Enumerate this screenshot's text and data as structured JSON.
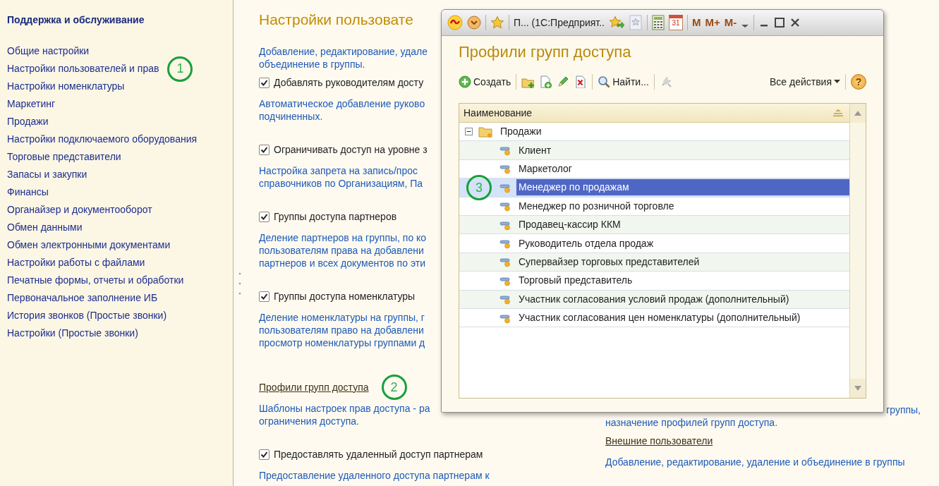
{
  "sidebar": {
    "title": "Поддержка и обслуживание",
    "items": [
      {
        "label": "Общие настройки"
      },
      {
        "label": "Настройки пользователей и прав",
        "annotation": "1"
      },
      {
        "label": "Настройки номенклатуры"
      },
      {
        "label": "Маркетинг"
      },
      {
        "label": "Продажи"
      },
      {
        "label": "Настройки подключаемого оборудования"
      },
      {
        "label": "Торговые представители"
      },
      {
        "label": "Запасы и закупки"
      },
      {
        "label": "Финансы"
      },
      {
        "label": "Органайзер и документооборот"
      },
      {
        "label": "Обмен данными"
      },
      {
        "label": "Обмен электронными документами"
      },
      {
        "label": "Настройки работы с файлами"
      },
      {
        "label": "Печатные формы, отчеты и обработки"
      },
      {
        "label": "Первоначальное заполнение ИБ"
      },
      {
        "label": "История звонков (Простые звонки)"
      },
      {
        "label": "Настройки (Простые звонки)"
      }
    ]
  },
  "main": {
    "title": "Настройки пользовате",
    "left": [
      {
        "kind": "text",
        "description": [
          "Добавление, редактирование, удале",
          "объединение в группы."
        ]
      },
      {
        "kind": "checkbox",
        "label": "Добавлять руководителям досту",
        "checked": true,
        "description": [
          "Автоматическое добавление руково",
          "подчиненных."
        ]
      },
      {
        "kind": "checkbox",
        "label": "Ограничивать доступ на уровне з",
        "checked": true,
        "description": [
          "Настройка запрета на запись/прос",
          "справочников по Организациям, Па"
        ]
      },
      {
        "kind": "checkbox",
        "label": "Группы доступа партнеров",
        "checked": true,
        "description": [
          "Деление партнеров на группы, по ко",
          "пользователям права на добавлени",
          "партнеров и всех документов по эти"
        ]
      },
      {
        "kind": "checkbox",
        "label": "Группы доступа номенклатуры",
        "checked": true,
        "description": [
          "Деление номенклатуры на группы, г",
          "пользователям право на добавлени",
          "просмотр номенклатуры группами д"
        ]
      },
      {
        "kind": "link",
        "label": "Профили групп доступа",
        "annotation": "2",
        "description": [
          "Шаблоны настроек прав доступа - ра",
          "ограничения доступа."
        ]
      },
      {
        "kind": "checkbox",
        "label": "Предоставлять удаленный доступ партнерам",
        "checked": true,
        "description": [
          "Предоставление удаленного доступа партнерам к"
        ]
      }
    ],
    "right": [
      {
        "kind": "text",
        "description": [
          "группы,",
          "назначение профилей групп доступа."
        ]
      },
      {
        "kind": "link",
        "label": "Внешние пользователи",
        "description": [
          "Добавление, редактирование, удаление и объединение в группы"
        ]
      }
    ]
  },
  "window": {
    "titlebar": {
      "title": "П... (1С:Предприят..",
      "calendar": "31",
      "memory_buttons": [
        "M",
        "M+",
        "M-"
      ]
    },
    "title": "Профили групп доступа",
    "toolbar": {
      "items": [
        {
          "kind": "create",
          "label": "Создать"
        },
        {
          "kind": "separator"
        },
        {
          "kind": "add-folder"
        },
        {
          "kind": "copy"
        },
        {
          "kind": "edit"
        },
        {
          "kind": "delete"
        },
        {
          "kind": "separator"
        },
        {
          "kind": "find",
          "label": "Найти..."
        },
        {
          "kind": "separator"
        },
        {
          "kind": "plug",
          "disabled": true
        }
      ],
      "menu": "Все действия",
      "help": "?"
    },
    "table": {
      "columns": [
        "Наименование"
      ],
      "rows": [
        {
          "label": "Продажи",
          "expanded": true,
          "selected": false,
          "children": [
            {
              "label": "Клиент",
              "selected": false
            },
            {
              "label": "Маркетолог",
              "selected": false
            },
            {
              "label": "Менеджер по продажам",
              "selected": true,
              "annotation": "3"
            },
            {
              "label": "Менеджер по розничной торговле",
              "selected": false
            },
            {
              "label": "Продавец-кассир ККМ",
              "selected": false
            },
            {
              "label": "Руководитель отдела продаж",
              "selected": false
            },
            {
              "label": "Супервайзер торговых представителей",
              "selected": false
            },
            {
              "label": "Торговый представитель",
              "selected": false
            },
            {
              "label": "Участник согласования условий продаж (дополнительный)",
              "selected": false
            },
            {
              "label": "Участник согласования цен номенклатуры (дополнительный)",
              "selected": false
            }
          ]
        }
      ]
    }
  }
}
